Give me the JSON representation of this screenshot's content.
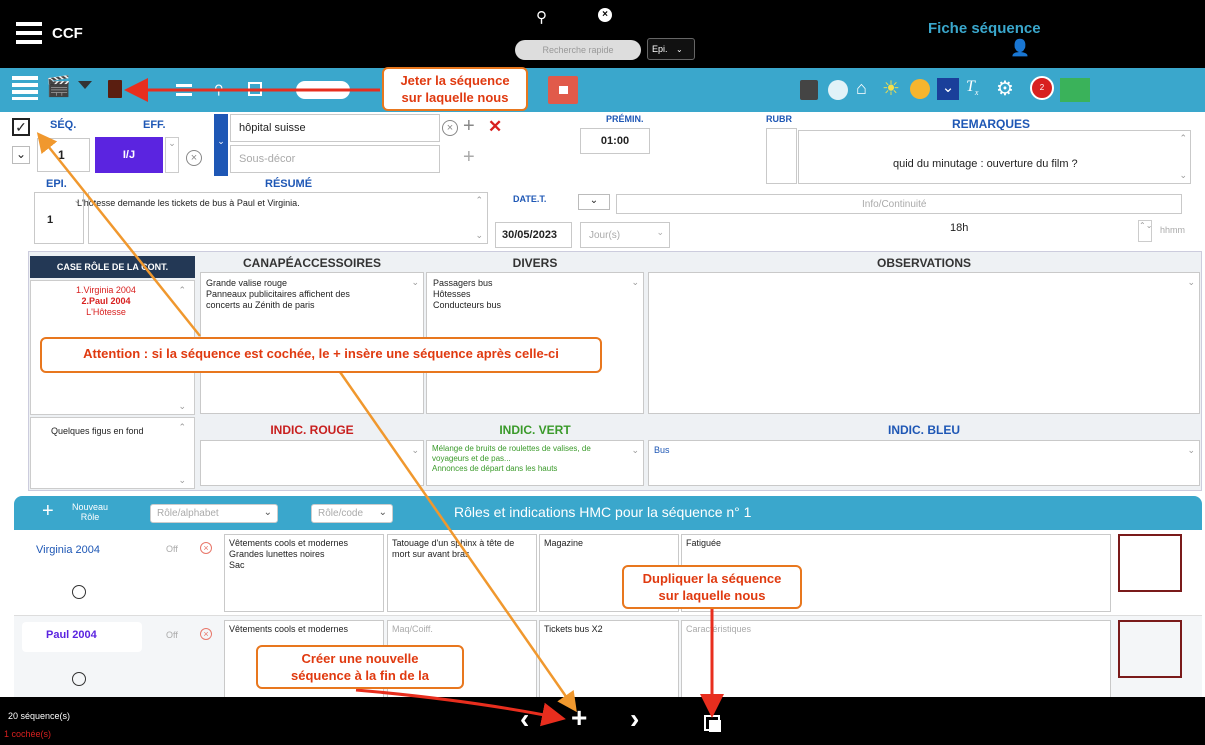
{
  "topbar": {
    "app_name": "CCF",
    "search_placeholder": "Recherche rapide",
    "epi_label": "Epi.",
    "page_title": "Fiche séquence"
  },
  "seq": {
    "seq_label": "SÉQ.",
    "eff_label": "EFF.",
    "number": "1",
    "eff_value": "I/J",
    "decor": "hôpital suisse",
    "sous_decor_placeholder": "Sous-décor",
    "premin_label": "PRÉMIN.",
    "premin_value": "01:00",
    "rubr_label": "RUBR",
    "remarques_label": "REMARQUES",
    "remarques_value": "quid du minutage : ouverture du film ?",
    "epi_label": "EPI.",
    "epi_value": "1",
    "resume_label": "RÉSUMÉ",
    "resume_value": "L'hôtesse demande les tickets de bus à Paul et Virginia.",
    "datet_label": "DATE.T.",
    "datet_value": "30/05/2023",
    "jour_placeholder": "Jour(s)",
    "info_placeholder": "Info/Continuité",
    "time_value": "18h",
    "hhmm_placeholder": "hhmm"
  },
  "roles_box": {
    "header": "CASE RÔLE DE LA CONT.",
    "items": [
      "1.Virginia 2004",
      "2.Paul 2004",
      "L'Hôtesse"
    ],
    "figurants": "Quelques figus en fond"
  },
  "grid": {
    "canape_label": "CANAPÉACCESSOIRES",
    "canape_text": "Grande valise rouge\nPanneaux publicitaires affichent des concerts au Zénith de paris",
    "divers_label": "DIVERS",
    "divers_text": "Passagers bus\nHôtesses\nConducteurs bus",
    "observations_label": "OBSERVATIONS",
    "rouge_label": "INDIC. ROUGE",
    "vert_label": "INDIC. VERT",
    "vert_text": "Mélange de bruits de roulettes de valises, de voyageurs et de pas...\nAnnonces de départ dans les hauts",
    "bleu_label": "INDIC. BLEU",
    "bleu_text": "Bus"
  },
  "roles_bar": {
    "new_role": "Nouveau Rôle",
    "sel1": "Rôle/alphabet",
    "sel2": "Rôle/code",
    "title": "Rôles et indications HMC pour la séquence n° 1"
  },
  "role_rows": [
    {
      "name": "Virginia 2004",
      "off": "Off",
      "c1": "Vêtements cools et modernes\nGrandes lunettes noires\nSac",
      "c2": "Tatouage d'un sphinx à tête de mort sur avant bras",
      "c3": "Magazine",
      "c4": "Fatiguée"
    },
    {
      "name": "Paul 2004",
      "off": "Off",
      "c1": "Vêtements cools et modernes",
      "c2": "Maq/Coiff.",
      "c3": "Tickets bus X2",
      "c4": "Caractéristiques"
    }
  ],
  "footer": {
    "count": "20 séquence(s)",
    "checked": "1 cochée(s)"
  },
  "callouts": {
    "jeter": "Jeter la séquence\nsur laquelle nous",
    "attention": "Attention : si la séquence est cochée, le + insère une séquence après celle-ci",
    "dupliquer": "Dupliquer la séquence\nsur laquelle nous",
    "creer": "Créer une nouvelle\nséquence à la fin de la"
  },
  "colors": {
    "accent": "#3aa7cc",
    "callout_border": "#e8771e",
    "callout_text": "#e03a10",
    "eff_purple": "#5b24e0"
  }
}
